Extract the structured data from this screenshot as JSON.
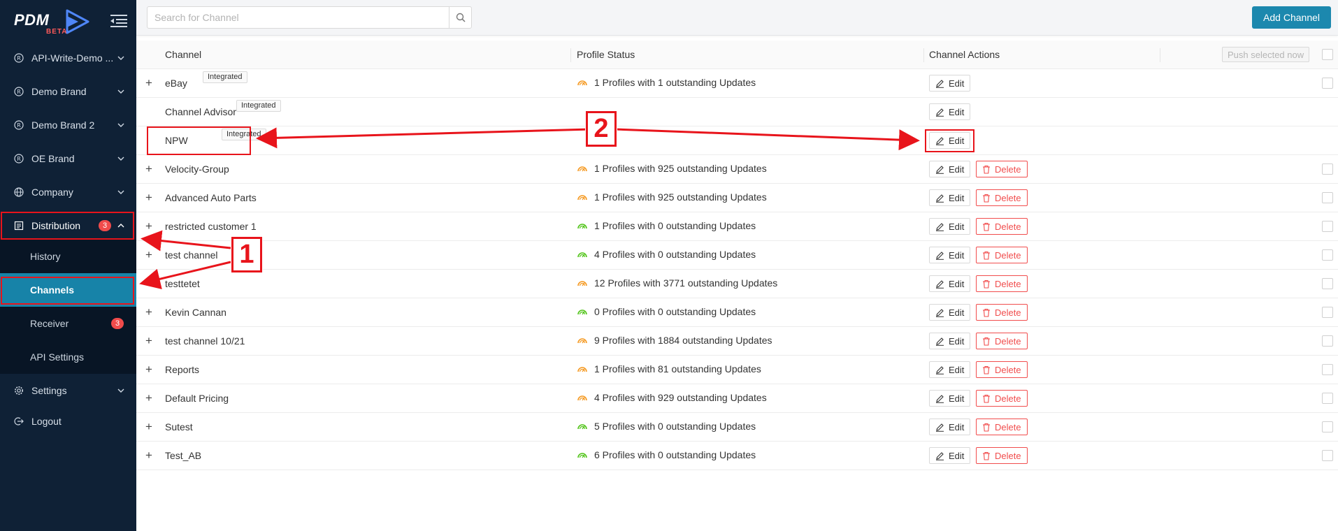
{
  "sidebar": {
    "logo_text": "PDM",
    "logo_beta": "BETA",
    "items": [
      {
        "label": "API-Write-Demo ..."
      },
      {
        "label": "Demo Brand"
      },
      {
        "label": "Demo Brand 2"
      },
      {
        "label": "OE Brand"
      },
      {
        "label": "Company"
      },
      {
        "label": "Distribution",
        "badge": "3"
      },
      {
        "label": "Settings"
      },
      {
        "label": "Logout"
      }
    ],
    "submenu": [
      {
        "label": "History"
      },
      {
        "label": "Channels"
      },
      {
        "label": "Receiver",
        "badge": "3"
      },
      {
        "label": "API Settings"
      }
    ]
  },
  "topbar": {
    "search_placeholder": "Search for Channel",
    "add_channel_label": "Add Channel"
  },
  "table": {
    "headers": {
      "channel": "Channel",
      "profile_status": "Profile Status",
      "channel_actions": "Channel Actions",
      "push_selected": "Push selected now"
    },
    "integrated_label": "Integrated",
    "edit_label": "Edit",
    "delete_label": "Delete",
    "rows": [
      {
        "name": "eBay",
        "integrated": true,
        "status": "1 Profiles with 1 outstanding Updates",
        "status_color": "#f59a23",
        "expandable": true,
        "deletable": false,
        "checkbox": true
      },
      {
        "name": "Channel Advisor",
        "integrated": true,
        "status": "",
        "status_color": "",
        "expandable": false,
        "deletable": false,
        "checkbox": false
      },
      {
        "name": "NPW",
        "integrated": true,
        "status": "",
        "status_color": "",
        "expandable": false,
        "deletable": false,
        "checkbox": false
      },
      {
        "name": "Velocity-Group",
        "integrated": false,
        "status": "1 Profiles with 925 outstanding Updates",
        "status_color": "#f59a23",
        "expandable": true,
        "deletable": true,
        "checkbox": true
      },
      {
        "name": "Advanced Auto Parts",
        "integrated": false,
        "status": "1 Profiles with 925 outstanding Updates",
        "status_color": "#f59a23",
        "expandable": true,
        "deletable": true,
        "checkbox": true
      },
      {
        "name": "restricted customer 1",
        "integrated": false,
        "status": "1 Profiles with 0 outstanding Updates",
        "status_color": "#52c41a",
        "expandable": true,
        "deletable": true,
        "checkbox": true
      },
      {
        "name": "test channel",
        "integrated": false,
        "status": "4 Profiles with 0 outstanding Updates",
        "status_color": "#52c41a",
        "expandable": true,
        "deletable": true,
        "checkbox": true
      },
      {
        "name": "testtetet",
        "integrated": false,
        "status": "12 Profiles with 3771 outstanding Updates",
        "status_color": "#f59a23",
        "expandable": true,
        "deletable": true,
        "checkbox": true
      },
      {
        "name": "Kevin Cannan",
        "integrated": false,
        "status": "0 Profiles with 0 outstanding Updates",
        "status_color": "#52c41a",
        "expandable": true,
        "deletable": true,
        "checkbox": true
      },
      {
        "name": "test channel 10/21",
        "integrated": false,
        "status": "9 Profiles with 1884 outstanding Updates",
        "status_color": "#f59a23",
        "expandable": true,
        "deletable": true,
        "checkbox": true
      },
      {
        "name": "Reports",
        "integrated": false,
        "status": "1 Profiles with 81 outstanding Updates",
        "status_color": "#f59a23",
        "expandable": true,
        "deletable": true,
        "checkbox": true
      },
      {
        "name": "Default Pricing",
        "integrated": false,
        "status": "4 Profiles with 929 outstanding Updates",
        "status_color": "#f59a23",
        "expandable": true,
        "deletable": true,
        "checkbox": true
      },
      {
        "name": "Sutest",
        "integrated": false,
        "status": "5 Profiles with 0 outstanding Updates",
        "status_color": "#52c41a",
        "expandable": true,
        "deletable": true,
        "checkbox": true
      },
      {
        "name": "Test_AB",
        "integrated": false,
        "status": "6 Profiles with 0 outstanding Updates",
        "status_color": "#52c41a",
        "expandable": true,
        "deletable": true,
        "checkbox": true
      }
    ]
  },
  "annotations": {
    "label_1": "1",
    "label_2": "2",
    "color": "#e8141b"
  },
  "colors": {
    "sidebar_bg": "#0f2136",
    "submenu_bg": "#081525",
    "accent": "#1783a8",
    "add_button": "#1c88ae",
    "danger": "#f14d4d"
  }
}
